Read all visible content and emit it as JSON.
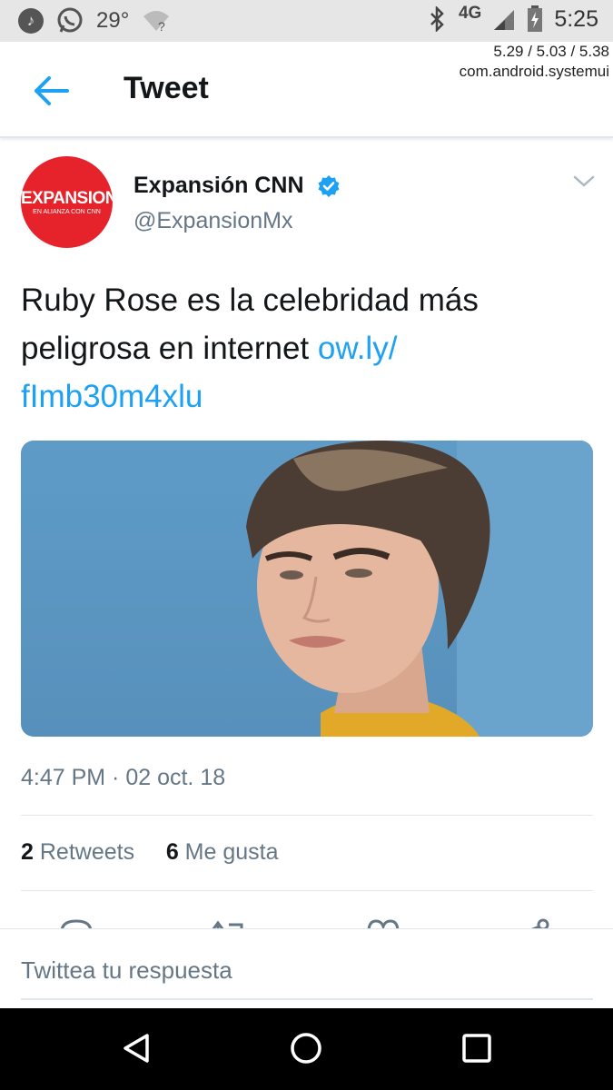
{
  "status_bar": {
    "temperature": "29°",
    "network": "4G",
    "time": "5:25",
    "debug_line1": "5.29 / 5.03 / 5.38",
    "debug_line2": "com.android.systemui"
  },
  "header": {
    "title": "Tweet"
  },
  "tweet": {
    "author_name": "Expansión CNN",
    "author_handle": "@ExpansionMx",
    "avatar_text": "EXPANSION",
    "avatar_subtext": "EN ALIANZA CON CNN",
    "text": "Ruby Rose es la celebridad más peligrosa en internet ",
    "link": "ow.ly/ fImb30m4xlu",
    "timestamp": "4:47 PM · 02 oct. 18",
    "retweets_count": "2",
    "retweets_label": "Retweets",
    "likes_count": "6",
    "likes_label": "Me gusta"
  },
  "reply": {
    "placeholder": "Twittea tu respuesta"
  },
  "colors": {
    "accent": "#1da1f2",
    "secondary_text": "#657786",
    "avatar_bg": "#e6222b"
  }
}
